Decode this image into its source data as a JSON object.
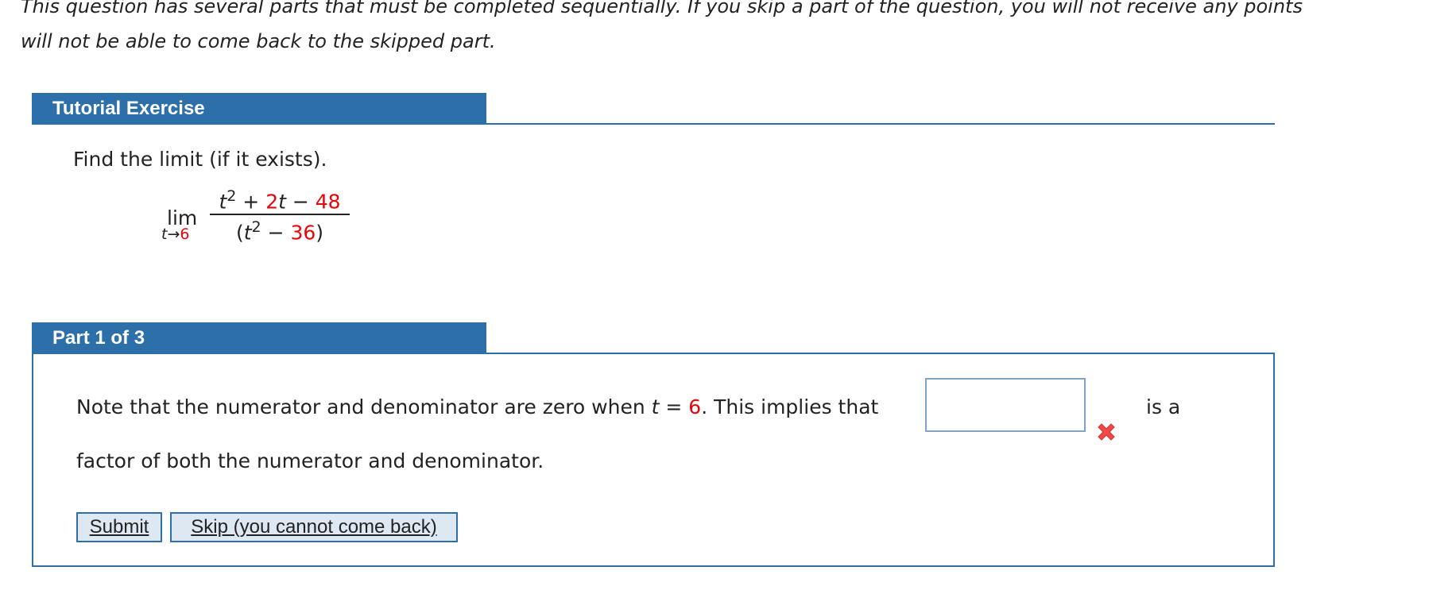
{
  "intro": {
    "line1": "This question has several parts that must be completed sequentially. If you skip a part of the question, you will not receive any points",
    "line2": "will not be able to come back to the skipped part."
  },
  "tutorial": {
    "header": "Tutorial Exercise",
    "prompt": "Find the limit (if it exists).",
    "limit": {
      "lim": "lim",
      "var": "t",
      "arrow": "→",
      "approach": "6",
      "num_t": "t",
      "num_exp": "2",
      "num_plus": " + ",
      "num_coef": "2",
      "num_t2": "t",
      "num_minus": " − ",
      "num_const": "48",
      "den_open": "(",
      "den_t": "t",
      "den_exp": "2",
      "den_minus": " − ",
      "den_const": "36",
      "den_close": ")"
    }
  },
  "part": {
    "header": "Part 1 of 3",
    "sentence_start": "Note that the numerator and denominator are zero when ",
    "sentence_var": "t",
    "sentence_eq": " = ",
    "sentence_val": "6",
    "sentence_mid": ". This implies that",
    "sentence_tail": "is a",
    "sentence2": "factor of both the numerator and denominator.",
    "answer_value": "",
    "status_color": "#f04a4a"
  },
  "buttons": {
    "submit": "Submit",
    "skip": "Skip (you cannot come back)"
  },
  "colors": {
    "accent": "#2d6fa9",
    "highlight": "#e8050a"
  }
}
